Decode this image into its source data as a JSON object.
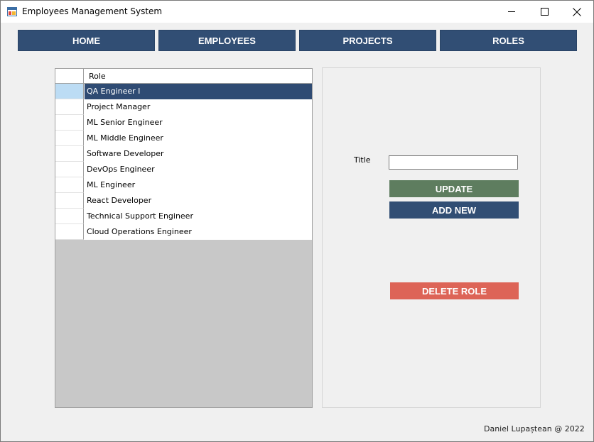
{
  "window": {
    "title": "Employees Management System",
    "icon": "app-window-icon",
    "controls": [
      "minimize-icon",
      "maximize-icon",
      "close-icon"
    ]
  },
  "nav": {
    "home": "HOME",
    "employees": "EMPLOYEES",
    "projects": "PROJECTS",
    "roles": "ROLES"
  },
  "grid": {
    "column_header": "Role",
    "selected_index": 0,
    "rows": [
      "QA Engineer I",
      "Project Manager",
      "ML Senior Engineer",
      "ML Middle Engineer",
      "Software Developer",
      "DevOps Engineer",
      "ML Engineer",
      "React Developer",
      "Technical Support Engineer",
      "Cloud Operations Engineer"
    ]
  },
  "form": {
    "title_label": "Title",
    "title_value": "",
    "update_label": "UPDATE",
    "add_label": "ADD NEW",
    "delete_label": "DELETE ROLE"
  },
  "footer": {
    "credit": "Daniel Lupaștean @ 2022"
  },
  "colors": {
    "nav": "#314e74",
    "selected_row": "#2f4b73",
    "update": "#5e7d5f",
    "add": "#314e74",
    "delete": "#dd6457"
  }
}
